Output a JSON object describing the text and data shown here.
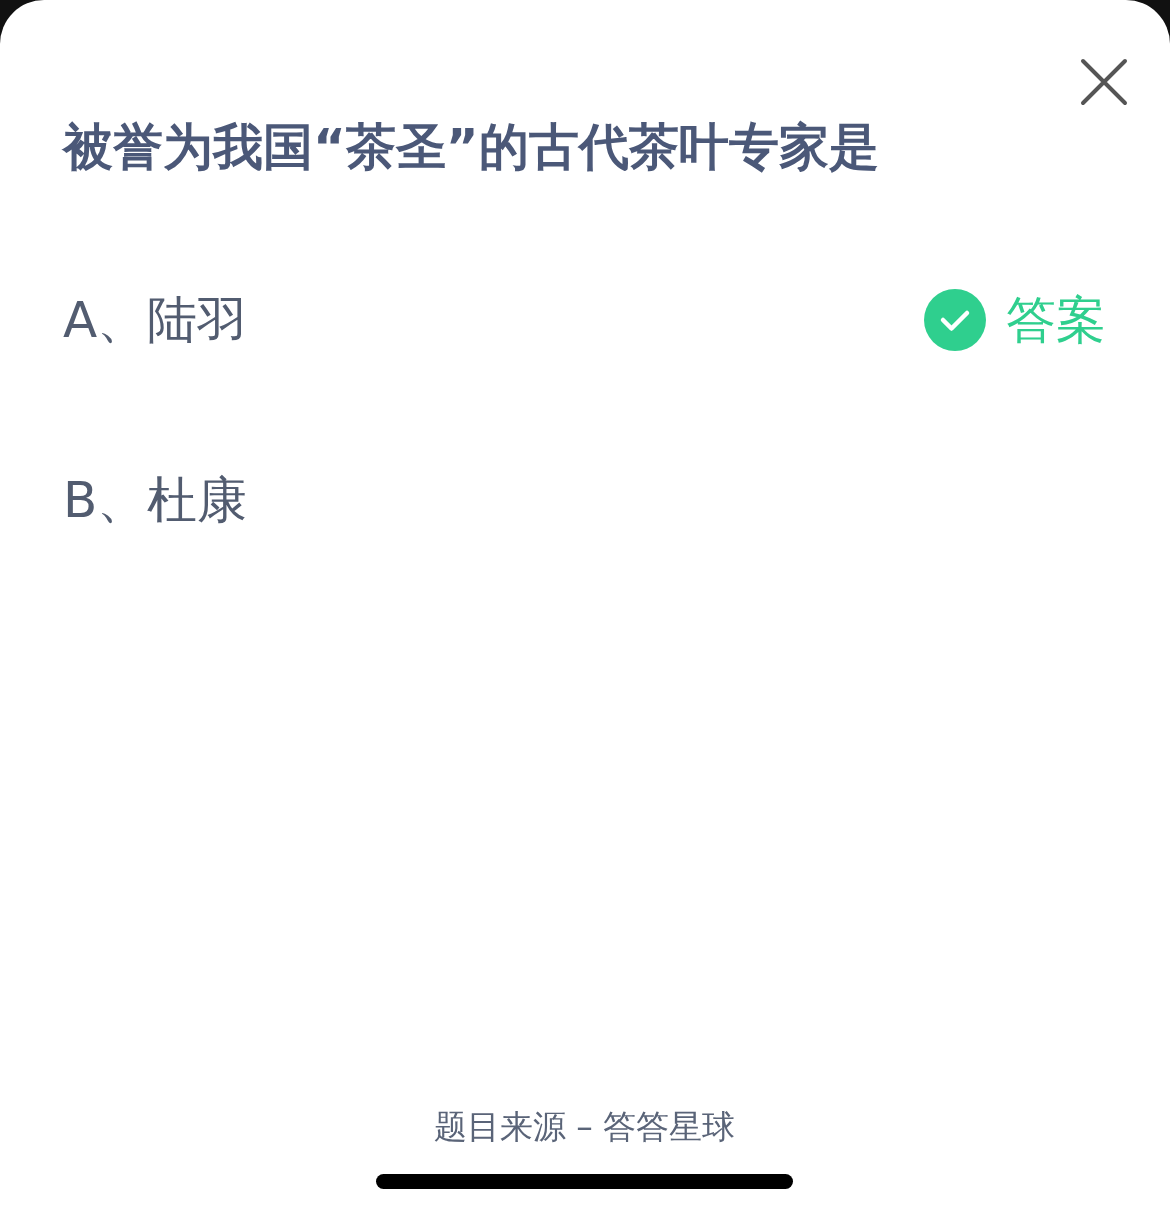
{
  "question": {
    "title": "被誉为我国“茶圣”的古代茶叶专家是"
  },
  "options": [
    {
      "text": "A、陆羽",
      "correct": true,
      "badge": "答案"
    },
    {
      "text": "B、杜康",
      "correct": false
    }
  ],
  "footer": "题目来源 – 答答星球"
}
